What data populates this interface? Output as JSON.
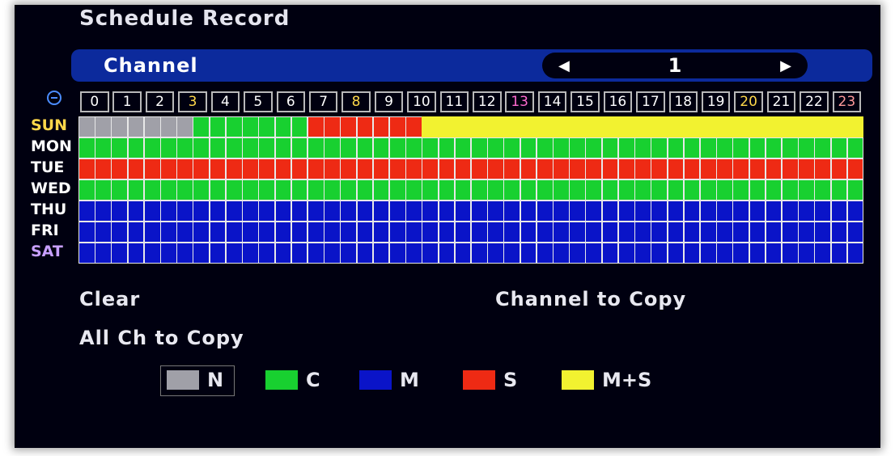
{
  "window": {
    "title": "Schedule Record"
  },
  "channel": {
    "label": "Channel",
    "value": "1"
  },
  "hours": [
    "0",
    "1",
    "2",
    "3",
    "4",
    "5",
    "6",
    "7",
    "8",
    "9",
    "10",
    "11",
    "12",
    "13",
    "14",
    "15",
    "16",
    "17",
    "18",
    "19",
    "20",
    "21",
    "22",
    "23"
  ],
  "hour_colors": [
    "#ffffff",
    "#ffffff",
    "#ffffff",
    "#ffd84a",
    "#ffffff",
    "#ffffff",
    "#ffffff",
    "#ffffff",
    "#ffd84a",
    "#ffffff",
    "#ffffff",
    "#ffffff",
    "#ffffff",
    "#ff6ad0",
    "#ffffff",
    "#ffffff",
    "#ffffff",
    "#ffffff",
    "#ffffff",
    "#ffffff",
    "#ffd84a",
    "#ffffff",
    "#ffffff",
    "#ff9a9a"
  ],
  "days": [
    {
      "label": "SUN",
      "color": "#ffd84a",
      "cells": [
        "N",
        "N",
        "N",
        "N",
        "N",
        "N",
        "N",
        "C",
        "C",
        "C",
        "C",
        "C",
        "C",
        "C",
        "S",
        "S",
        "S",
        "S",
        "S",
        "S",
        "S",
        "MS",
        "MS",
        "MS",
        "MS",
        "MS",
        "MS",
        "MS",
        "MS",
        "MS",
        "MS",
        "MS",
        "MS",
        "MS",
        "MS",
        "MS",
        "MS",
        "MS",
        "MS",
        "MS",
        "MS",
        "MS",
        "MS",
        "MS",
        "MS",
        "MS",
        "MS",
        "MS"
      ]
    },
    {
      "label": "MON",
      "color": "#ffffff",
      "fill": "C"
    },
    {
      "label": "TUE",
      "color": "#ffffff",
      "fill": "S"
    },
    {
      "label": "WED",
      "color": "#ffffff",
      "fill": "C"
    },
    {
      "label": "THU",
      "color": "#ffffff",
      "fill": "M"
    },
    {
      "label": "FRI",
      "color": "#ffffff",
      "fill": "M"
    },
    {
      "label": "SAT",
      "color": "#c8a0ff",
      "fill": "M"
    }
  ],
  "colors": {
    "N": "#a0a0a8",
    "C": "#18d030",
    "M": "#0a14c8",
    "S": "#ee2a14",
    "MS": "#f2f230"
  },
  "buttons": {
    "clear": "Clear",
    "channel_copy": "Channel to Copy",
    "all_copy": "All Ch to Copy"
  },
  "legend": [
    {
      "key": "N",
      "label": "N",
      "color": "#a0a0a8"
    },
    {
      "key": "C",
      "label": "C",
      "color": "#18d030"
    },
    {
      "key": "M",
      "label": "M",
      "color": "#0a14c8"
    },
    {
      "key": "S",
      "label": "S",
      "color": "#ee2a14"
    },
    {
      "key": "MS",
      "label": "M+S",
      "color": "#f2f230"
    }
  ]
}
